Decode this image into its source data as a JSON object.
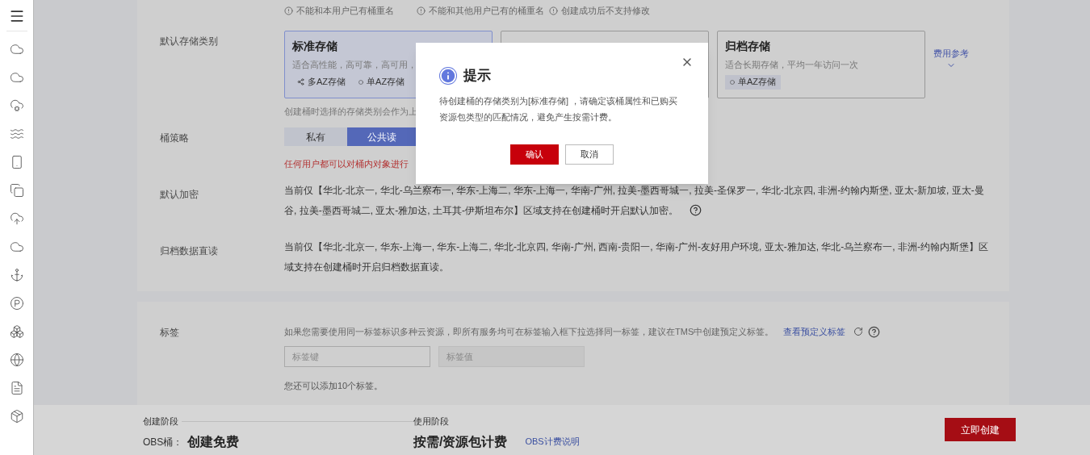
{
  "hints": [
    "不能和本用户已有桶重名",
    "不能和其他用户已有的桶重名",
    "创建成功后不支持修改"
  ],
  "storage_class": {
    "label": "默认存储类别",
    "options": [
      {
        "title": "标准存储",
        "description": "适合高性能，高可靠，高可用，",
        "tags": [
          {
            "kind": "multi",
            "text": "多AZ存储"
          },
          {
            "kind": "single",
            "text": "单AZ存储"
          }
        ],
        "selected": true
      },
      {
        "selected": false
      },
      {
        "title": "归档存储",
        "description": "适合长期存储，平均一年访问一次",
        "tags": [
          {
            "kind": "single",
            "text": "单AZ存储"
          }
        ],
        "selected": false
      }
    ],
    "fee_link": "费用参考",
    "note": "创建桶时选择的存储类别会作为上"
  },
  "bucket_policy": {
    "label": "桶策略",
    "options": [
      {
        "label": "私有",
        "selected": false
      },
      {
        "label": "公共读",
        "selected": true
      }
    ],
    "warning": "任何用户都可以对桶内对象进行"
  },
  "default_encryption": {
    "label": "默认加密",
    "text": "当前仅【华北-北京一, 华北-乌兰察布一, 华东-上海二, 华东-上海一, 华南-广州, 拉美-墨西哥城一, 拉美-圣保罗一, 华北-北京四, 非洲-约翰内斯堡, 亚太-新加坡, 亚太-曼谷, 拉美-墨西哥城二, 亚太-雅加达, 土耳其-伊斯坦布尔】区域支持在创建桶时开启默认加密。"
  },
  "archive_direct_read": {
    "label": "归档数据直读",
    "text": "当前仅【华北-北京一, 华东-上海一, 华东-上海二, 华北-北京四, 华南-广州, 西南-贵阳一, 华南-广州-友好用户环境, 亚太-雅加达, 华北-乌兰察布一, 非洲-约翰内斯堡】区域支持在创建桶时开启归档数据直读。"
  },
  "tags": {
    "label": "标签",
    "description": "如果您需要使用同一标签标识多种云资源，即所有服务均可在标签输入框下拉选择同一标签，建议在TMS中创建预定义标签。",
    "link": "查看预定义标签",
    "key_field": {
      "placeholder": "标签键",
      "disabled": false
    },
    "value_field": {
      "placeholder": "标签值",
      "disabled": true
    },
    "remaining": "您还可以添加10个标签。"
  },
  "footer": {
    "create_stage": {
      "label": "创建阶段",
      "prefix": "OBS桶：",
      "value": "创建免费"
    },
    "use_stage": {
      "label": "使用阶段",
      "value": "按需/资源包计费",
      "link": "OBS计费说明"
    },
    "create_button": "立即创建"
  },
  "dialog": {
    "title": "提示",
    "message": "待创建桶的存储类别为[标准存储] ，请确定该桶属性和已购买资源包类型的匹配情况，避免产生按需计费。",
    "buttons": [
      {
        "kind": "primary",
        "label": "确认"
      },
      {
        "kind": "secondary",
        "label": "取消"
      }
    ]
  }
}
